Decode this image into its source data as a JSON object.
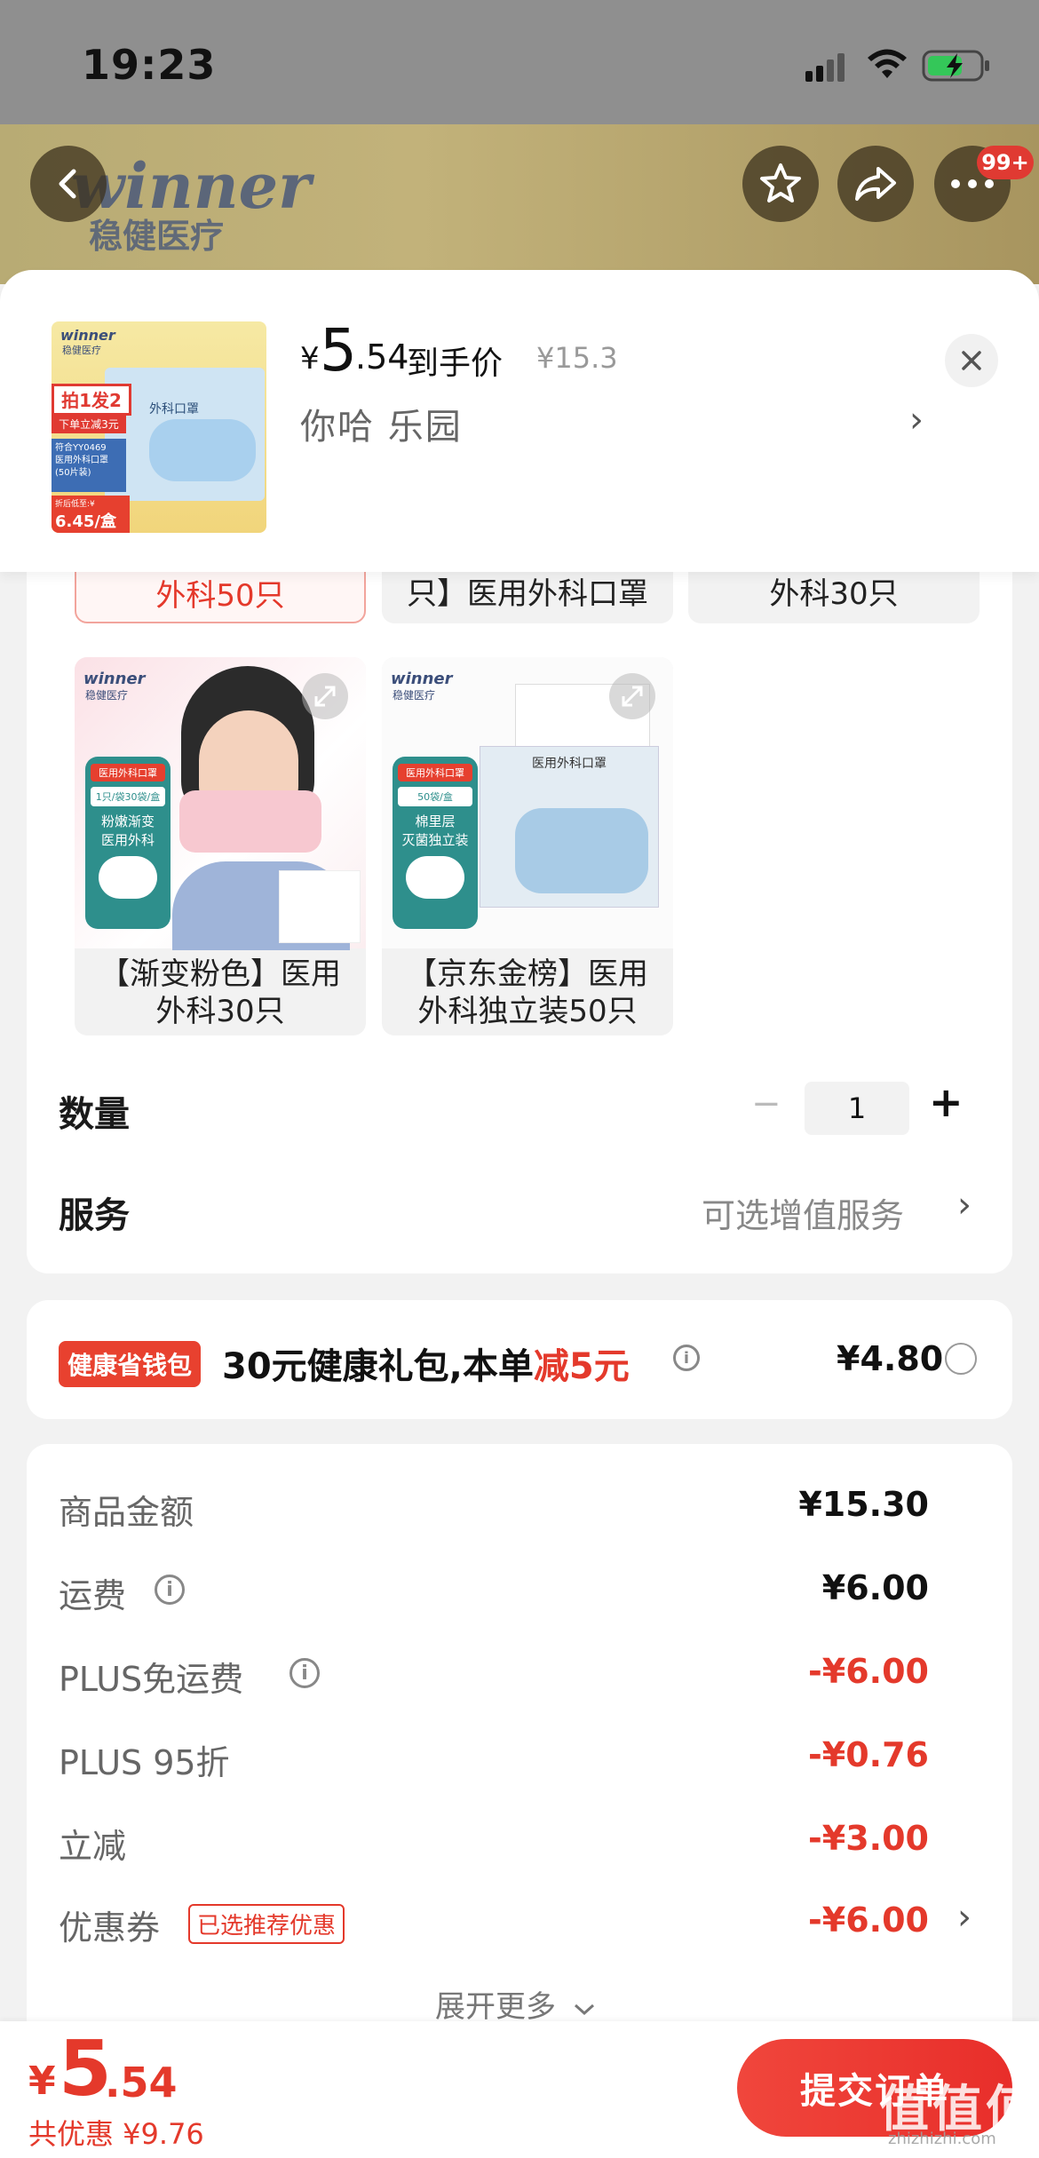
{
  "status_bar": {
    "time": "19:23"
  },
  "banner": {
    "brand_en": "winner",
    "brand_cn": "稳健医疗",
    "badge": "99+"
  },
  "sheet": {
    "price_currency": "¥",
    "price_int": "5",
    "price_dec": ".54",
    "price_label": "到手价",
    "original_price": "¥15.3",
    "selected_spec": "你哈  乐园",
    "thumb": {
      "brand": "winner",
      "brand_cn": "稳健医疗",
      "promo1": "拍1发2",
      "promo2": "下单立减3元",
      "line1": "符合YY0469",
      "line2": "医用外科口罩",
      "line3": "(50片装)",
      "small": "折后低至:¥",
      "price": "6.45/盒",
      "mask_label": "外科口罩"
    }
  },
  "grid": {
    "partial_row": [
      "外科50只",
      "只】医用外科口罩",
      "外科30只"
    ],
    "cards": [
      {
        "title_line1": "【渐变粉色】医用",
        "title_line2": "外科30只",
        "img_brand": "winner",
        "img_brand_cn": "稳健医疗",
        "img_tag": "医用外科口罩",
        "img_sub": "1只/袋30袋/盒",
        "img_desc1": "粉嫩渐变",
        "img_desc2": "医用外科"
      },
      {
        "title_line1": "【京东金榜】医用",
        "title_line2": "外科独立装50只",
        "img_brand": "winner",
        "img_brand_cn": "稳健医疗",
        "img_tag": "医用外科口罩",
        "img_sub": "50袋/盒",
        "img_desc1": "棉里层",
        "img_desc2": "灭菌独立装",
        "box_label": "医用外科口罩"
      }
    ]
  },
  "quantity": {
    "label": "数量",
    "value": "1",
    "minus": "−",
    "plus": "+"
  },
  "service": {
    "label": "服务",
    "value": "可选增值服务",
    "chevron": "›"
  },
  "wallet": {
    "tag": "健康省钱包",
    "text_before": "30元健康礼包,本单",
    "text_red": "减5元",
    "info": "i",
    "price": "¥4.80"
  },
  "summary": {
    "rows": [
      {
        "label": "商品金额",
        "value": "¥15.30"
      },
      {
        "label": "运费",
        "value": "¥6.00"
      },
      {
        "label": "PLUS免运费",
        "value": "-¥6.00"
      },
      {
        "label": "PLUS 95折",
        "value": "-¥0.76"
      },
      {
        "label": "立减",
        "value": "-¥3.00"
      },
      {
        "label": "优惠券",
        "value": "-¥6.00",
        "tag": "已选推荐优惠"
      }
    ],
    "expand": "展开更多"
  },
  "bottom": {
    "currency": "¥",
    "price_int": "5",
    "price_dec": ".54",
    "discount": "共优惠 ¥9.76",
    "submit": "提交订单",
    "watermark": "值值值",
    "watermark_url": "zhizhizhi.com"
  },
  "colors": {
    "accent": "#e4392b",
    "tag_bg": "#e8412f",
    "muted": "#888888"
  },
  "icons": [
    "back-icon",
    "star-icon",
    "share-icon",
    "more-icon",
    "close-icon",
    "expand-icon",
    "info-icon",
    "radio-icon",
    "chevron-right-icon",
    "chevron-down-icon"
  ]
}
